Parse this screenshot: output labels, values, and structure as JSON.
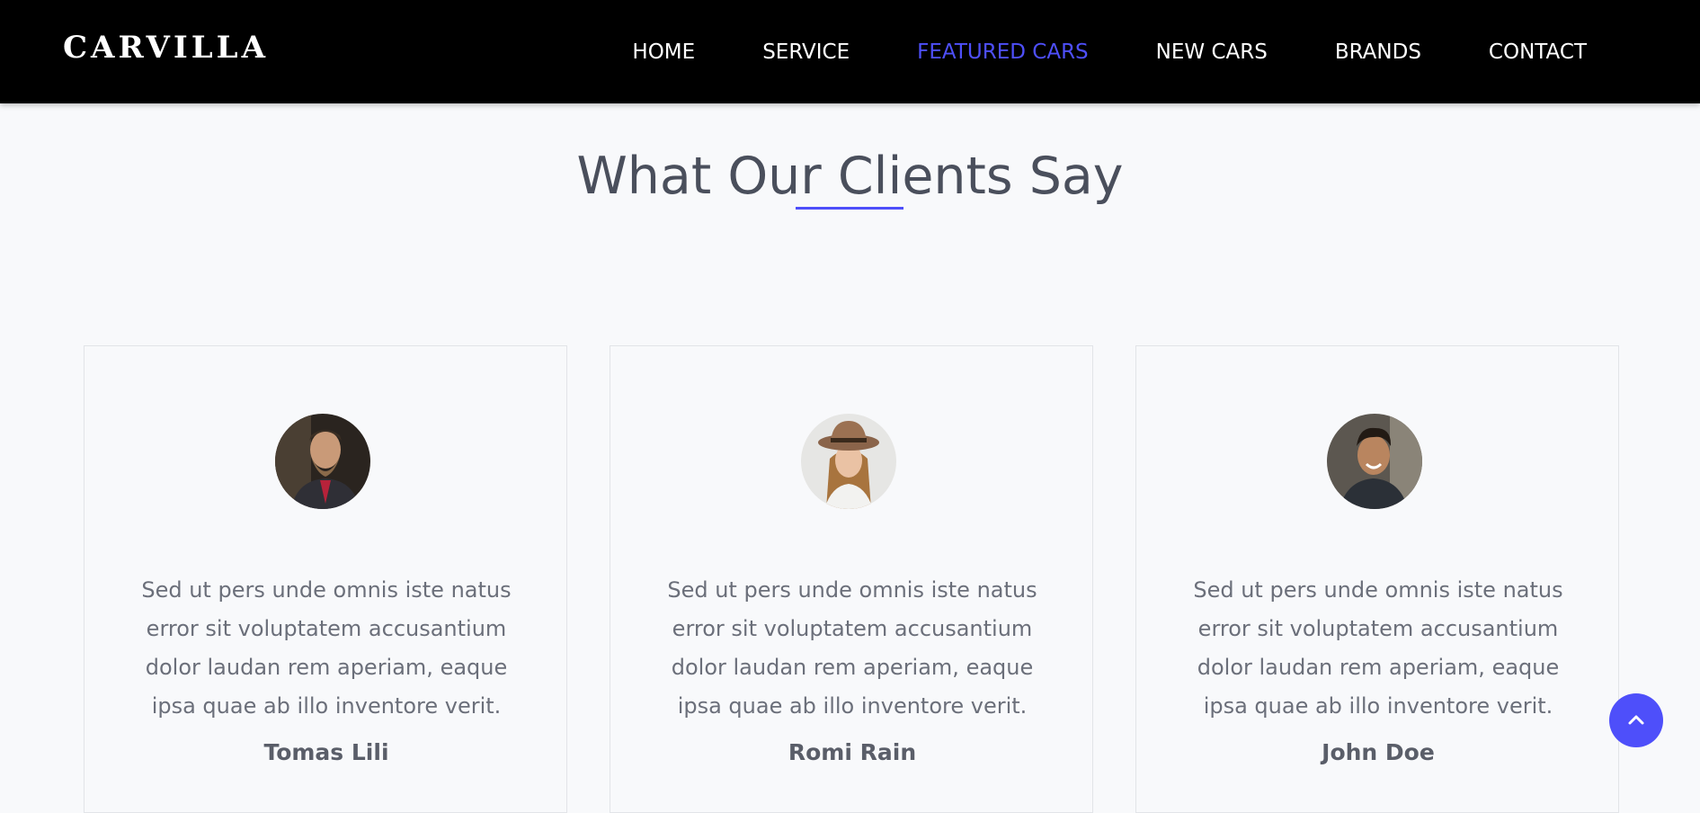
{
  "brand": {
    "logo_text": "CARVILLA"
  },
  "nav": {
    "items": [
      {
        "label": "HOME"
      },
      {
        "label": "SERVICE"
      },
      {
        "label": "FEATURED CARS"
      },
      {
        "label": "NEW CARS"
      },
      {
        "label": "BRANDS"
      },
      {
        "label": "CONTACT"
      }
    ],
    "active_item": "FEATURED CARS"
  },
  "section": {
    "title": "What Our Clients Say"
  },
  "testimonials": [
    {
      "text": "Sed ut pers unde omnis iste natus error sit voluptatem accusantium dolor laudan rem aperiam, eaque ipsa quae ab illo inventore verit.",
      "name": "Tomas Lili"
    },
    {
      "text": "Sed ut pers unde omnis iste natus error sit voluptatem accusantium dolor laudan rem aperiam, eaque ipsa quae ab illo inventore verit.",
      "name": "Romi Rain"
    },
    {
      "text": "Sed ut pers unde omnis iste natus error sit voluptatem accusantium dolor laudan rem aperiam, eaque ipsa quae ab illo inventore verit.",
      "name": "John Doe"
    }
  ],
  "icons": {
    "back_to_top": "chevron-up-icon"
  },
  "colors": {
    "accent": "#4e4ffa",
    "navbar_bg": "#000000",
    "page_bg": "#f8f9fb"
  }
}
